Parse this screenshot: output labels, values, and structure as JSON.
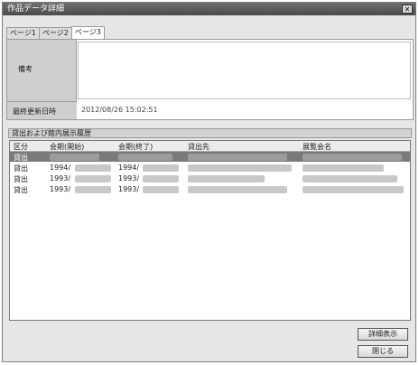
{
  "window": {
    "title": "作品データ詳細"
  },
  "tabs": [
    {
      "label": "ページ1"
    },
    {
      "label": "ページ2"
    },
    {
      "label": "ページ3"
    }
  ],
  "remarks": {
    "label": "備考",
    "value": ""
  },
  "last_updated": {
    "label": "最終更新日時",
    "value": "2012/08/26 15:02:51"
  },
  "history": {
    "title": "貸出および館内展示履歴",
    "columns": [
      "区分",
      "会期(開始)",
      "会期(終了)",
      "貸出先",
      "展覧会名"
    ],
    "rows": [
      {
        "kind": "貸出",
        "start": "",
        "end": ""
      },
      {
        "kind": "貸出",
        "start": "1994/",
        "end": "1994/"
      },
      {
        "kind": "貸出",
        "start": "1993/",
        "end": "1993/"
      },
      {
        "kind": "貸出",
        "start": "1993/",
        "end": "1993/"
      }
    ]
  },
  "buttons": {
    "detail": "詳細表示",
    "close": "閉じる"
  }
}
